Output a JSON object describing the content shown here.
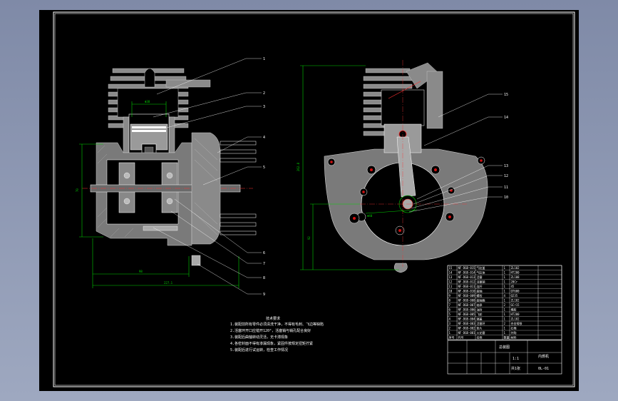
{
  "drawing": {
    "part_balloons_left": [
      "1",
      "2",
      "3",
      "4",
      "5",
      "6",
      "7",
      "8",
      "9"
    ],
    "part_balloons_right": [
      "15",
      "14",
      "13",
      "12",
      "11",
      "10"
    ],
    "dimensions": {
      "left_bottom_1": "98",
      "left_bottom_2": "227.1",
      "left_side": "70",
      "piston_bore": "Φ38",
      "right_total": "262.8",
      "right_lower": "92",
      "crank": "Φ40"
    },
    "notes": {
      "title": "技术要求",
      "lines": [
        "1.装配前所有零件必须清洗干净，不得有毛刺、飞边等缺陷",
        "2.活塞环开口应错开120°，活塞销与销孔配合良好",
        "3.装配后曲轴转动灵活，无卡滞现象",
        "4.各密封面不得有渗漏现象，紧固件按规定扭矩拧紧",
        "5.装配后进行试运转，检查工作情况"
      ]
    },
    "title_block": {
      "drawing_name": "总装图",
      "school": "内燃机",
      "drawing_no": "0L-01",
      "scale": "1:1",
      "sheet": "共1张",
      "bom_rows": [
        [
          "15",
          "NF-DGB-015",
          "气缸盖",
          "1",
          "ZL102"
        ],
        [
          "14",
          "NF-DGB-014",
          "气缸体",
          "1",
          "HT200"
        ],
        [
          "13",
          "NF-DGB-013",
          "活塞",
          "1",
          "ZL108"
        ],
        [
          "12",
          "NF-DGB-012",
          "活塞销",
          "1",
          "20Cr"
        ],
        [
          "11",
          "NF-DGB-011",
          "连杆",
          "1",
          "45"
        ],
        [
          "10",
          "NF-DGB-010",
          "曲轴",
          "1",
          "QT600"
        ],
        [
          "9",
          "NF-DGB-009",
          "螺栓",
          "4",
          "Q235"
        ],
        [
          "8",
          "NF-DGB-008",
          "曲轴箱",
          "1",
          "ZL102"
        ],
        [
          "7",
          "NF-DGB-007",
          "轴承",
          "2",
          "GCr15"
        ],
        [
          "6",
          "NF-DGB-006",
          "油封",
          "1",
          "橡胶"
        ],
        [
          "5",
          "NF-DGB-005",
          "飞轮",
          "1",
          "HT200"
        ],
        [
          "4",
          "NF-DGB-004",
          "端盖",
          "1",
          "ZL102"
        ],
        [
          "3",
          "NF-DGB-003",
          "活塞环",
          "2",
          "合金铸铁"
        ],
        [
          "2",
          "NF-DGB-002",
          "垫片",
          "1",
          "石棉"
        ],
        [
          "1",
          "NF-DGB-001",
          "火花塞",
          "1",
          "外购"
        ]
      ],
      "header": [
        "序号",
        "代号",
        "名称",
        "数量",
        "材料"
      ]
    }
  }
}
